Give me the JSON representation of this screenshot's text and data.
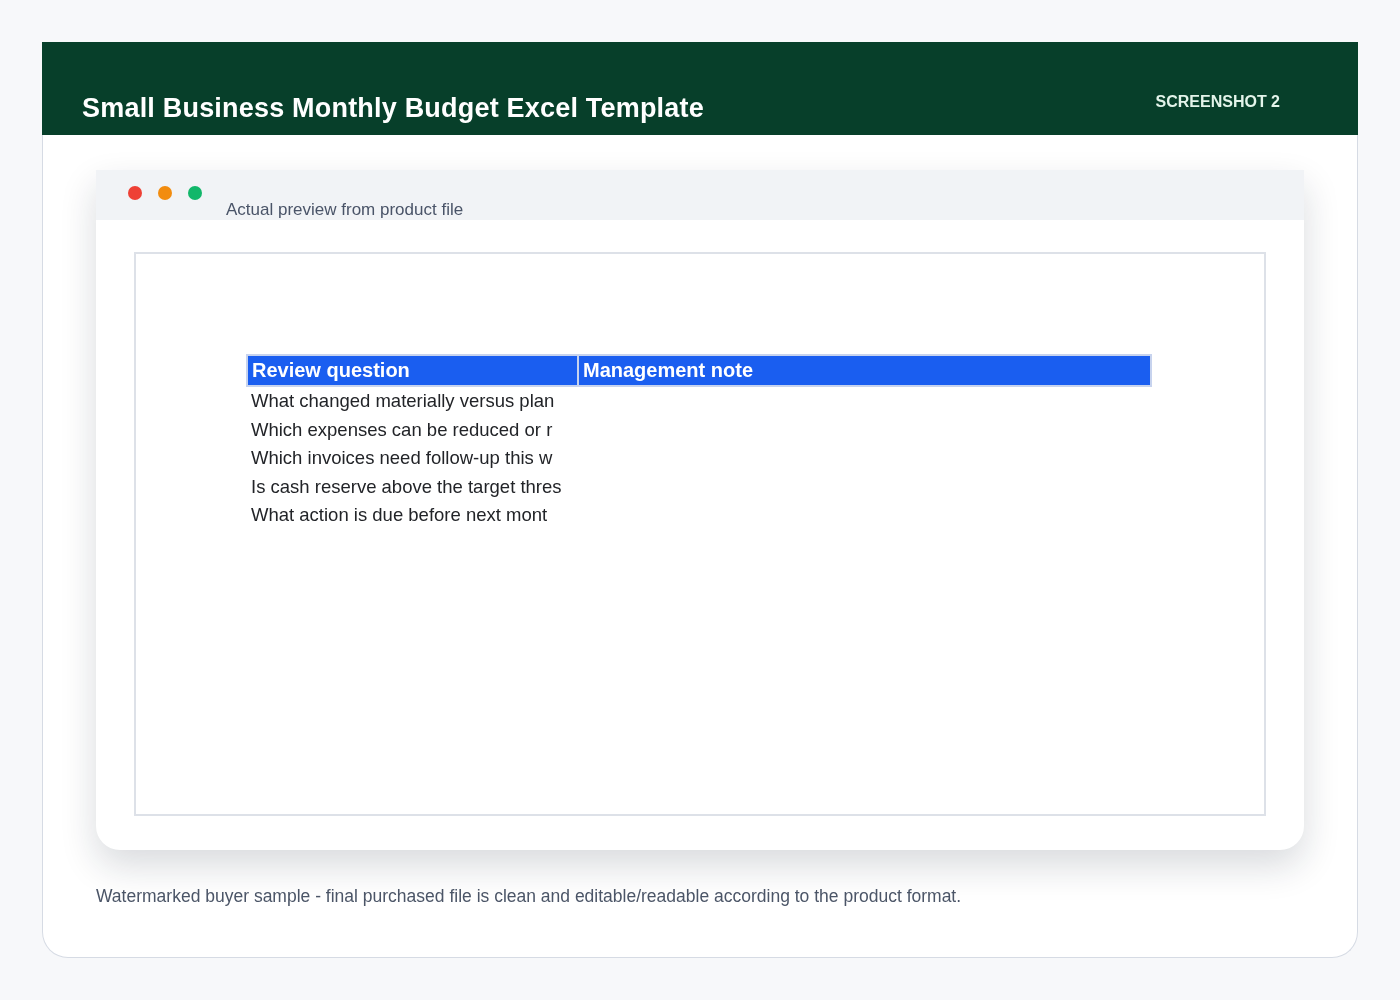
{
  "header": {
    "title": "Small Business Monthly Budget Excel Template",
    "badge": "SCREENSHOT 2"
  },
  "preview_window": {
    "traffic_lights": [
      {
        "color": "#ee4035"
      },
      {
        "color": "#f28c0f"
      },
      {
        "color": "#12b76a"
      }
    ],
    "caption": "Actual preview from product file",
    "table": {
      "columns": [
        "Review question",
        "Management note"
      ],
      "rows": [
        [
          "What changed materially versus plan"
        ],
        [
          "Which expenses can be reduced or r"
        ],
        [
          "Which invoices need follow-up this w"
        ],
        [
          "Is cash reserve above the target thres"
        ],
        [
          "What action is due before next mont"
        ]
      ]
    }
  },
  "footer_note": "Watermarked buyer sample - final purchased file is clean and editable/readable according to the product format."
}
